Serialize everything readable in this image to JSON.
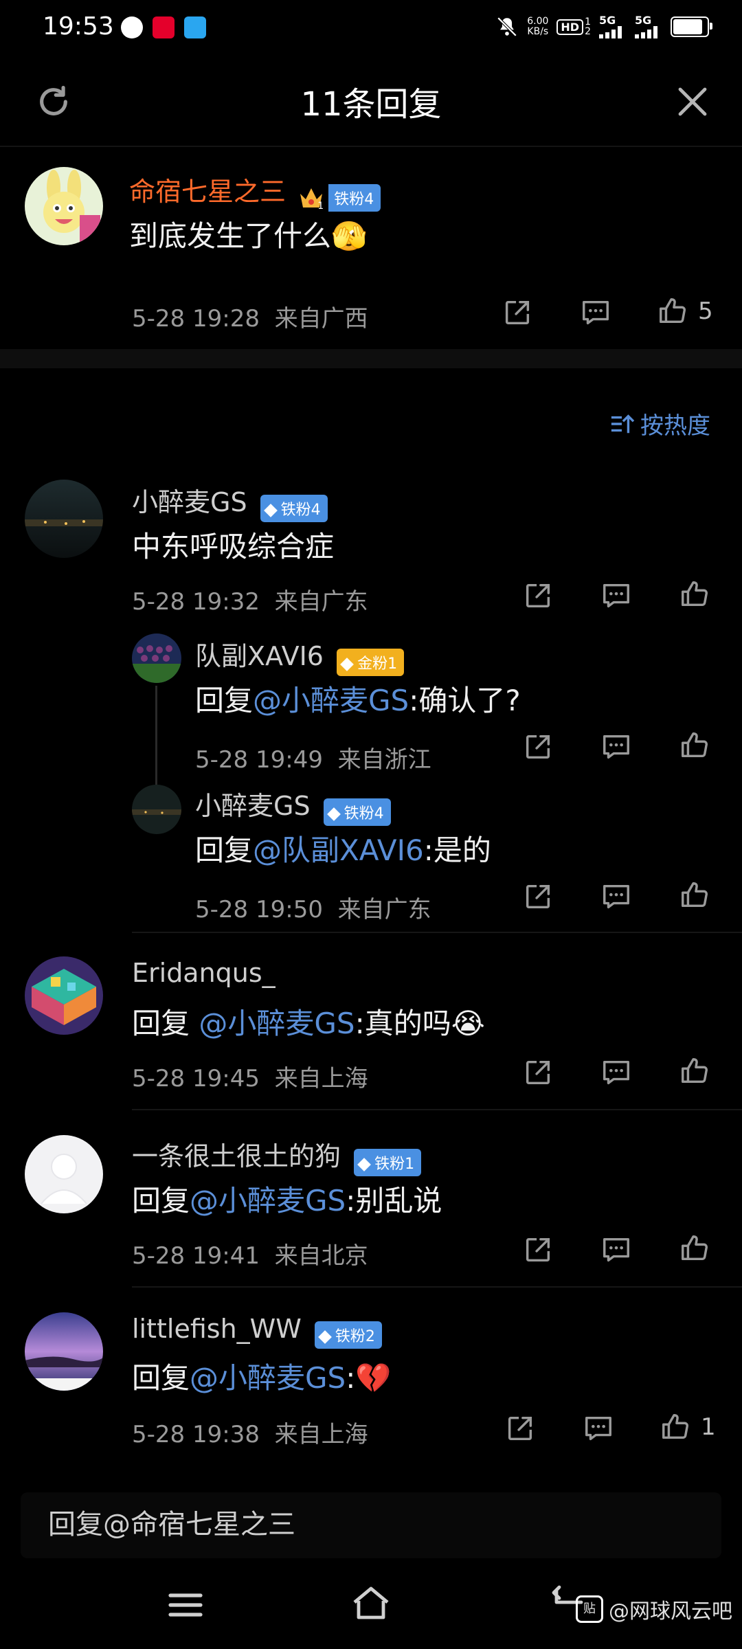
{
  "status_bar": {
    "time": "19:53",
    "net_speed_value": "6.00",
    "net_speed_unit": "KB/s",
    "hd_label": "HD",
    "hd_sim_1": "1",
    "hd_sim_2": "2",
    "sig1": "5G",
    "sig2": "5G"
  },
  "header": {
    "title": "11条回复"
  },
  "main_comment": {
    "user": "命宿七星之三",
    "badge": "铁粉4",
    "crown_level": "1",
    "text": "到底发生了什么",
    "emoji": "🫣",
    "time": "5-28 19:28",
    "location": "来自广西",
    "likes": "5"
  },
  "sort": {
    "label": "按热度"
  },
  "replies": [
    {
      "user": "小醉麦GS",
      "badge": "铁粉4",
      "text": "中东呼吸综合症",
      "time": "5-28 19:32",
      "location": "来自广东",
      "sub": [
        {
          "user": "队副XAVI6",
          "badge": "金粉1",
          "prefix": "回复",
          "mention": "@小醉麦GS",
          "text": ":确认了?",
          "time": "5-28 19:49",
          "location": "来自浙江"
        },
        {
          "user": "小醉麦GS",
          "badge": "铁粉4",
          "prefix": "回复",
          "mention": "@队副XAVI6",
          "text": ":是的",
          "time": "5-28 19:50",
          "location": "来自广东"
        }
      ]
    },
    {
      "user": "Eridanqus_",
      "prefix": "回复 ",
      "mention": "@小醉麦GS",
      "text": ":真的吗",
      "emoji": "😭",
      "time": "5-28 19:45",
      "location": "来自上海"
    },
    {
      "user": "一条很土很土的狗",
      "badge": "铁粉1",
      "prefix": "回复",
      "mention": "@小醉麦GS",
      "text": ":别乱说",
      "time": "5-28 19:41",
      "location": "来自北京"
    },
    {
      "user": "littlefish_WW",
      "badge": "铁粉2",
      "prefix": "回复",
      "mention": "@小醉麦GS",
      "text": ":",
      "emoji": "💔",
      "time": "5-28 19:38",
      "location": "来自上海",
      "likes": "1"
    }
  ],
  "input": {
    "placeholder": "回复@命宿七星之三"
  },
  "watermark": {
    "icon_text": "贴",
    "text": "@网球风云吧"
  },
  "colors": {
    "accent_blue": "#5b8fd8",
    "username_orange": "#ff6a2b",
    "badge_blue": "#4a90e2",
    "badge_gold": "#f2b01e"
  }
}
